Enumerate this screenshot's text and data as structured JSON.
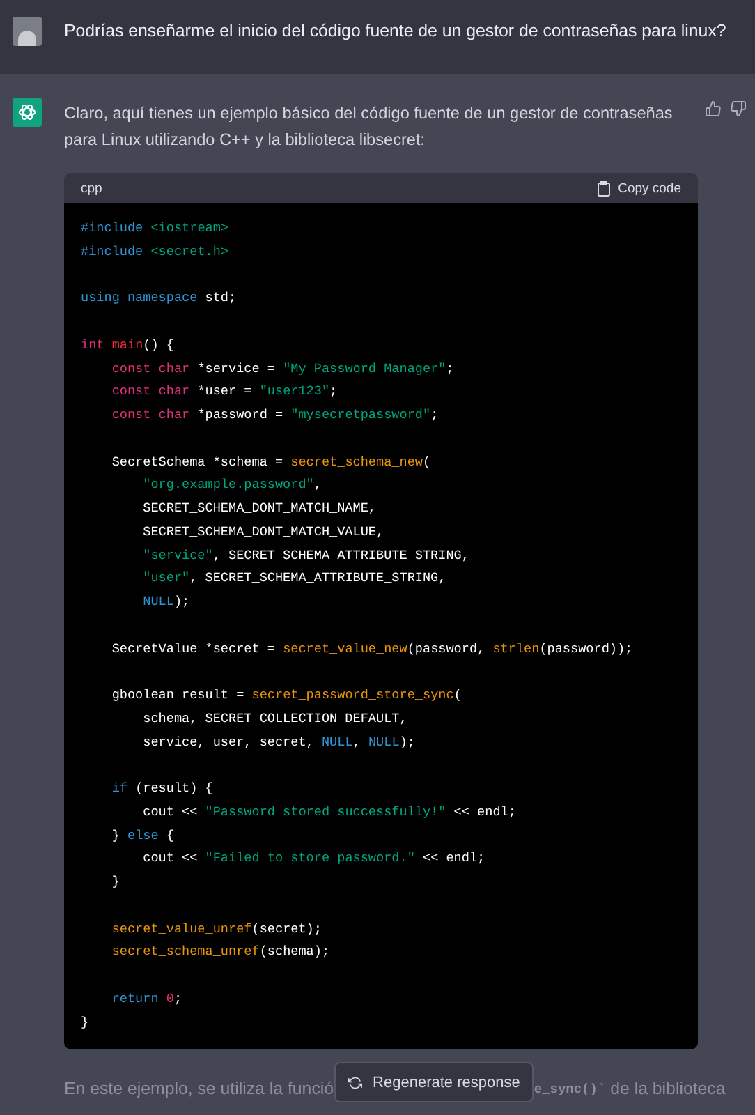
{
  "user_message": {
    "text": "Podrías enseñarme el inicio del código fuente de un gestor de contraseñas para linux?"
  },
  "assistant_message": {
    "text": "Claro, aquí tienes un ejemplo básico del código fuente de un gestor de contraseñas para Linux utilizando C++ y la biblioteca libsecret:",
    "code_block": {
      "language": "cpp",
      "copy_label": "Copy code",
      "lines": [
        {
          "gap_before": false,
          "tokens": [
            {
              "t": "#include ",
              "kind": "keyword"
            },
            {
              "t": "<iostream>",
              "kind": "string"
            }
          ]
        },
        {
          "gap_before": false,
          "tokens": [
            {
              "t": "#include ",
              "kind": "keyword"
            },
            {
              "t": "<secret.h>",
              "kind": "string"
            }
          ]
        },
        {
          "gap_before": true,
          "tokens": [
            {
              "t": "using namespace ",
              "kind": "keyword"
            },
            {
              "t": "std;",
              "kind": "plain"
            }
          ]
        },
        {
          "gap_before": true,
          "tokens": [
            {
              "t": "int ",
              "kind": "type"
            },
            {
              "t": "main",
              "kind": "title"
            },
            {
              "t": "() {",
              "kind": "plain"
            }
          ]
        },
        {
          "gap_before": false,
          "tokens": [
            {
              "t": "    const char ",
              "kind": "type"
            },
            {
              "t": "*service = ",
              "kind": "plain"
            },
            {
              "t": "\"My Password Manager\"",
              "kind": "string"
            },
            {
              "t": ";",
              "kind": "plain"
            }
          ]
        },
        {
          "gap_before": false,
          "tokens": [
            {
              "t": "    const char ",
              "kind": "type"
            },
            {
              "t": "*user = ",
              "kind": "plain"
            },
            {
              "t": "\"user123\"",
              "kind": "string"
            },
            {
              "t": ";",
              "kind": "plain"
            }
          ]
        },
        {
          "gap_before": false,
          "tokens": [
            {
              "t": "    const char ",
              "kind": "type"
            },
            {
              "t": "*password = ",
              "kind": "plain"
            },
            {
              "t": "\"mysecretpassword\"",
              "kind": "string"
            },
            {
              "t": ";",
              "kind": "plain"
            }
          ]
        },
        {
          "gap_before": true,
          "tokens": [
            {
              "t": "    SecretSchema *schema = ",
              "kind": "plain"
            },
            {
              "t": "secret_schema_new",
              "kind": "function"
            },
            {
              "t": "(",
              "kind": "plain"
            }
          ]
        },
        {
          "gap_before": false,
          "tokens": [
            {
              "t": "        \"org.example.password\"",
              "kind": "string"
            },
            {
              "t": ",",
              "kind": "plain"
            }
          ]
        },
        {
          "gap_before": false,
          "tokens": [
            {
              "t": "        SECRET_SCHEMA_DONT_MATCH_NAME,",
              "kind": "plain"
            }
          ]
        },
        {
          "gap_before": false,
          "tokens": [
            {
              "t": "        SECRET_SCHEMA_DONT_MATCH_VALUE,",
              "kind": "plain"
            }
          ]
        },
        {
          "gap_before": false,
          "tokens": [
            {
              "t": "        \"service\"",
              "kind": "string"
            },
            {
              "t": ", SECRET_SCHEMA_ATTRIBUTE_STRING,",
              "kind": "plain"
            }
          ]
        },
        {
          "gap_before": false,
          "tokens": [
            {
              "t": "        \"user\"",
              "kind": "string"
            },
            {
              "t": ", SECRET_SCHEMA_ATTRIBUTE_STRING,",
              "kind": "plain"
            }
          ]
        },
        {
          "gap_before": false,
          "tokens": [
            {
              "t": "        NULL",
              "kind": "keyword"
            },
            {
              "t": ");",
              "kind": "plain"
            }
          ]
        },
        {
          "gap_before": true,
          "tokens": [
            {
              "t": "    SecretValue *secret = ",
              "kind": "plain"
            },
            {
              "t": "secret_value_new",
              "kind": "function"
            },
            {
              "t": "(password, ",
              "kind": "plain"
            },
            {
              "t": "strlen",
              "kind": "function"
            },
            {
              "t": "(password));",
              "kind": "plain"
            }
          ]
        },
        {
          "gap_before": true,
          "tokens": [
            {
              "t": "    gboolean result = ",
              "kind": "plain"
            },
            {
              "t": "secret_password_store_sync",
              "kind": "function"
            },
            {
              "t": "(",
              "kind": "plain"
            }
          ]
        },
        {
          "gap_before": false,
          "tokens": [
            {
              "t": "        schema, SECRET_COLLECTION_DEFAULT,",
              "kind": "plain"
            }
          ]
        },
        {
          "gap_before": false,
          "tokens": [
            {
              "t": "        service, user, secret, ",
              "kind": "plain"
            },
            {
              "t": "NULL",
              "kind": "keyword"
            },
            {
              "t": ", ",
              "kind": "plain"
            },
            {
              "t": "NULL",
              "kind": "keyword"
            },
            {
              "t": ");",
              "kind": "plain"
            }
          ]
        },
        {
          "gap_before": true,
          "tokens": [
            {
              "t": "    if",
              "kind": "keyword"
            },
            {
              "t": " (result) {",
              "kind": "plain"
            }
          ]
        },
        {
          "gap_before": false,
          "tokens": [
            {
              "t": "        cout << ",
              "kind": "plain"
            },
            {
              "t": "\"Password stored successfully!\"",
              "kind": "string"
            },
            {
              "t": " << endl;",
              "kind": "plain"
            }
          ]
        },
        {
          "gap_before": false,
          "tokens": [
            {
              "t": "    } ",
              "kind": "plain"
            },
            {
              "t": "else",
              "kind": "keyword"
            },
            {
              "t": " {",
              "kind": "plain"
            }
          ]
        },
        {
          "gap_before": false,
          "tokens": [
            {
              "t": "        cout << ",
              "kind": "plain"
            },
            {
              "t": "\"Failed to store password.\"",
              "kind": "string"
            },
            {
              "t": " << endl;",
              "kind": "plain"
            }
          ]
        },
        {
          "gap_before": false,
          "tokens": [
            {
              "t": "    }",
              "kind": "plain"
            }
          ]
        },
        {
          "gap_before": true,
          "tokens": [
            {
              "t": "    secret_value_unref",
              "kind": "function"
            },
            {
              "t": "(secret);",
              "kind": "plain"
            }
          ]
        },
        {
          "gap_before": false,
          "tokens": [
            {
              "t": "    secret_schema_unref",
              "kind": "function"
            },
            {
              "t": "(schema);",
              "kind": "plain"
            }
          ]
        },
        {
          "gap_before": true,
          "tokens": [
            {
              "t": "    return ",
              "kind": "keyword"
            },
            {
              "t": "0",
              "kind": "number"
            },
            {
              "t": ";",
              "kind": "plain"
            }
          ]
        },
        {
          "gap_before": false,
          "tokens": [
            {
              "t": "}",
              "kind": "plain"
            }
          ]
        }
      ]
    },
    "trailing_text": [
      {
        "t": "En este ejemplo, se utiliza la funció",
        "kind": "prose"
      },
      {
        "t": "e_sync()`",
        "kind": "code"
      },
      {
        "t": " de la biblioteca",
        "kind": "prose"
      }
    ]
  },
  "regenerate_button": {
    "label": "Regenerate response"
  }
}
